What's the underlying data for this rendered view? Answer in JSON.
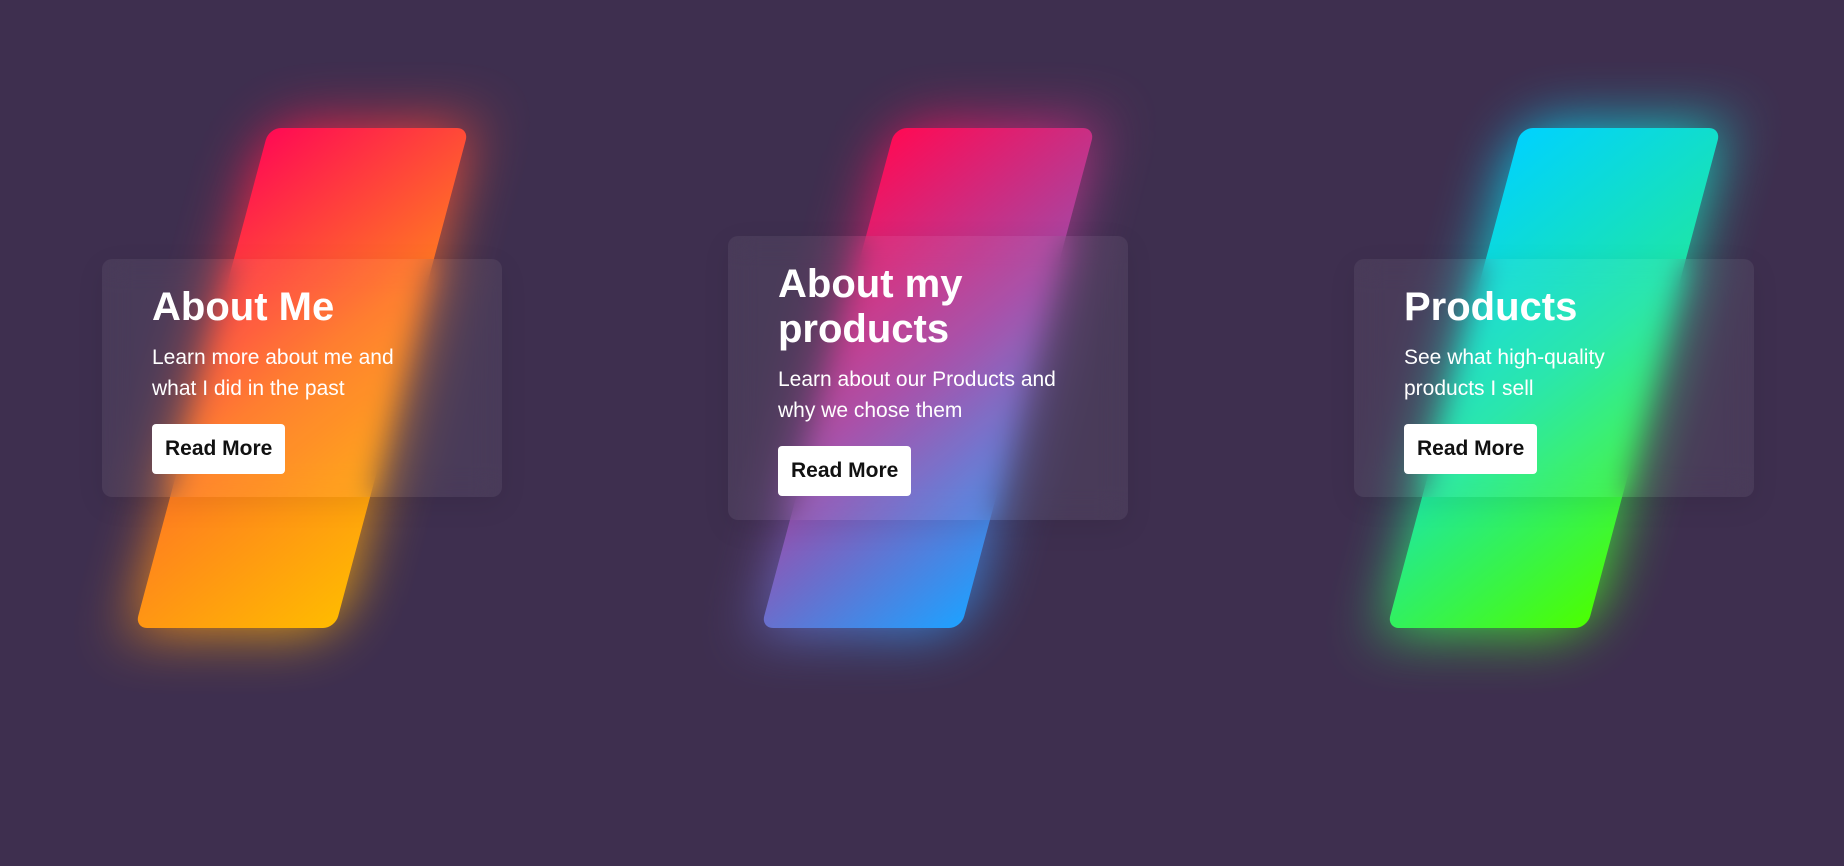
{
  "background": "#3e2f4f",
  "cards": [
    {
      "title": "About Me",
      "description": "Learn more about me and what I did in the past",
      "button_label": "Read More",
      "gradient": [
        "#ff0a54",
        "#ff7a22",
        "#ffbb00"
      ]
    },
    {
      "title": "About my products",
      "description": "Learn about our Products and why we chose them",
      "button_label": "Read More",
      "gradient": [
        "#ff0a54",
        "#a04aa8",
        "#1ea1ff"
      ]
    },
    {
      "title": "Products",
      "description": "See what high-quality products I sell",
      "button_label": "Read More",
      "gradient": [
        "#00d2ff",
        "#1ee6a5",
        "#4cff00"
      ]
    }
  ]
}
